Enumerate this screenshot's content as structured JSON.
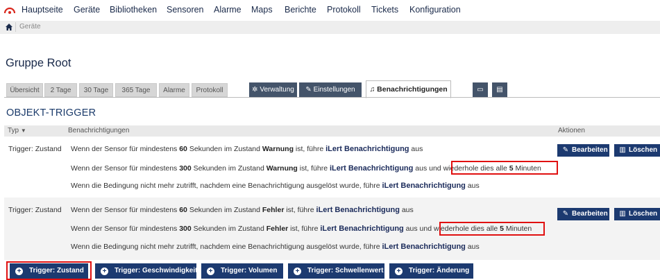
{
  "nav": {
    "items": [
      "Hauptseite",
      "Geräte",
      "Bibliotheken",
      "Sensoren",
      "Alarme",
      "Maps",
      "Berichte",
      "Protokoll",
      "Tickets",
      "Konfiguration"
    ]
  },
  "breadcrumb": {
    "current": "Geräte"
  },
  "page_title": "Gruppe Root",
  "tabs": {
    "light": [
      "Übersicht",
      "2 Tage",
      "30 Tage",
      "365 Tage",
      "Alarme",
      "Protokoll"
    ],
    "verwaltung": "Verwaltung",
    "einstellungen": "Einstellungen",
    "benachrichtigungen": "Benachrichtigungen"
  },
  "section_title": "OBJEKT-TRIGGER",
  "table": {
    "col_type": "Typ",
    "col_notifications": "Benachrichtigungen",
    "col_actions": "Aktionen",
    "rows": [
      {
        "type": "Trigger: Zustand",
        "state": "Warnung",
        "l1_a": "Wenn der Sensor für mindestens ",
        "l1_sec": "60",
        "l1_b": " Sekunden im Zustand ",
        "l1_c": " ist, führe ",
        "l1_d": " aus",
        "l2_sec": "300",
        "l2_e": " aus und ",
        "repeat_a": "wiederhole dies alle ",
        "repeat_n": "5",
        "repeat_b": " Minuten",
        "l3": "Wenn die Bedingung nicht mehr zutrifft, nachdem eine Benachrichtigung ausgelöst wurde, führe ",
        "l3_end": " aus"
      },
      {
        "type": "Trigger: Zustand",
        "state": "Fehler",
        "l1_sec": "60",
        "l2_sec": "300",
        "repeat_n": "5"
      }
    ],
    "notification": "iLert Benachrichtigung",
    "edit_label": "Bearbeiten",
    "delete_label": "Löschen"
  },
  "bottom_buttons": [
    "Trigger: Zustand",
    "Trigger: Geschwindigkeit",
    "Trigger: Volumen",
    "Trigger: Schwellenwert",
    "Trigger: Änderung"
  ],
  "colors": {
    "accent": "#1c3a70",
    "highlight": "#e01010",
    "logo": "#d9271d"
  }
}
